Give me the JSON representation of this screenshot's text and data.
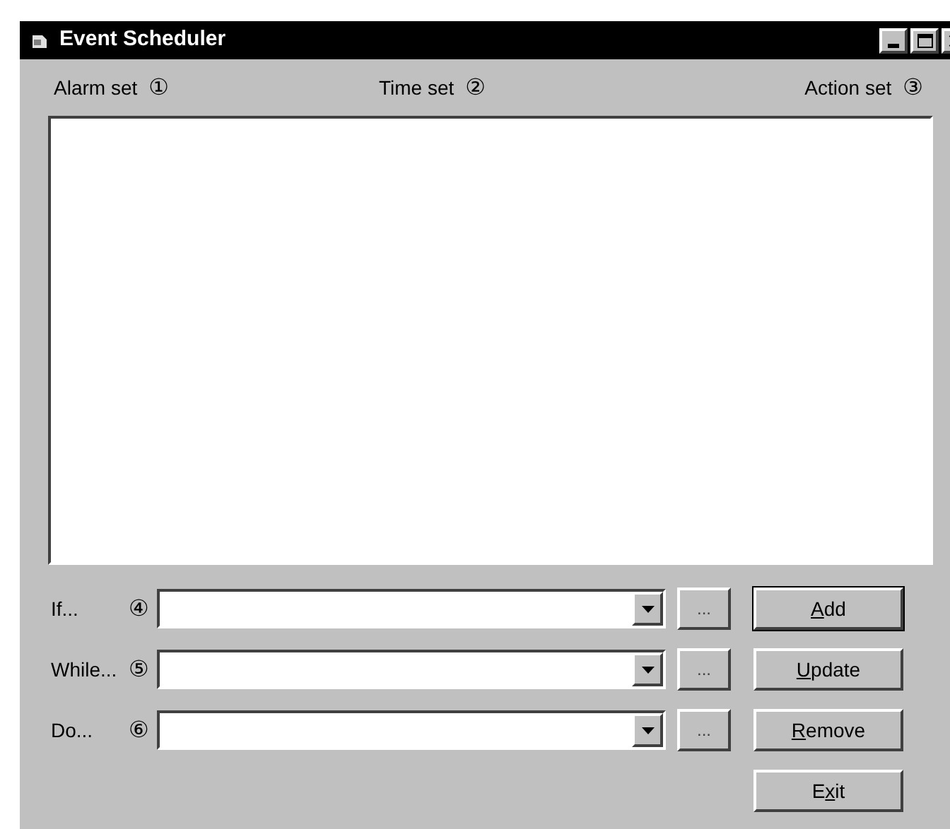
{
  "window": {
    "title": "Event Scheduler"
  },
  "headers": [
    {
      "label": "Alarm set",
      "marker": "①"
    },
    {
      "label": "Time set",
      "marker": "②"
    },
    {
      "label": "Action set",
      "marker": "③"
    }
  ],
  "conditions": [
    {
      "label": "If...",
      "marker": "④"
    },
    {
      "label": "While...",
      "marker": "⑤"
    },
    {
      "label": "Do...",
      "marker": "⑥"
    }
  ],
  "browse_label": "...",
  "buttons": [
    {
      "access_key": "A",
      "rest": "dd",
      "default": true
    },
    {
      "access_key": "U",
      "rest": "pdate",
      "default": false
    },
    {
      "access_key": "R",
      "rest": "emove",
      "default": false
    },
    {
      "before": "E",
      "access_key": "x",
      "rest": "it",
      "default": false
    }
  ]
}
